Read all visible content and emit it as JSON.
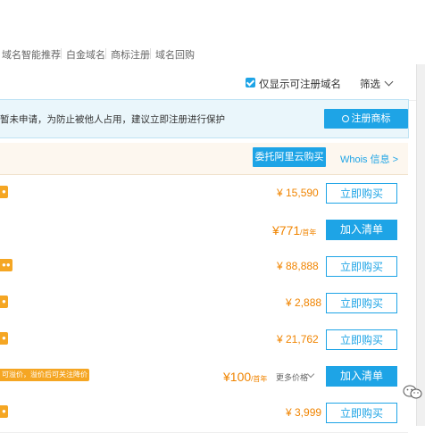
{
  "nav": {
    "items": [
      "域名智能推荐",
      "白金域名",
      "商标注册",
      "域名回购"
    ]
  },
  "filter": {
    "checkbox_label": "仅显示可注册域名",
    "select_label": "筛选"
  },
  "notice": {
    "text": "暂未申请，为防止被他人占用，建议立即注册进行保护",
    "button": "注册商标"
  },
  "agent": {
    "button": "委托阿里云购买",
    "whois": "Whois 信息 >"
  },
  "rows": [
    {
      "tag": "",
      "price": "¥ 15,590",
      "action": "立即购买"
    },
    {
      "tag": "",
      "price": "¥771",
      "unit": "/首年",
      "action": "加入清单"
    },
    {
      "tag": "",
      "price": "¥ 88,888",
      "action": "立即购买"
    },
    {
      "tag": "",
      "price": "¥ 2,888",
      "action": "立即购买"
    },
    {
      "tag": "",
      "price": "¥ 21,762",
      "action": "立即购买"
    },
    {
      "tag": "可溢价，溢价后可关注降价",
      "price": "¥100",
      "unit": "/首年",
      "more": "更多价格",
      "action": "加入清单"
    },
    {
      "tag": "",
      "price": "¥ 3,999",
      "action": "立即购买"
    }
  ],
  "colors": {
    "accent": "#1ea4e6",
    "price": "#f08400",
    "tag": "#f5a623"
  }
}
